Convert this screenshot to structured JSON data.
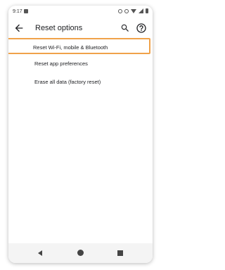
{
  "status_bar": {
    "time": "9:17"
  },
  "app_bar": {
    "title": "Reset options",
    "back_icon": "arrow-back-icon",
    "search_icon": "search-icon",
    "help_icon": "help-circle-icon"
  },
  "options": [
    {
      "label": "Reset Wi-Fi, mobile & Bluetooth",
      "highlighted": true
    },
    {
      "label": "Reset app preferences",
      "highlighted": false
    },
    {
      "label": "Erase all data (factory reset)",
      "highlighted": false
    }
  ],
  "colors": {
    "highlight_border": "#f0a24a",
    "text": "#202124"
  }
}
